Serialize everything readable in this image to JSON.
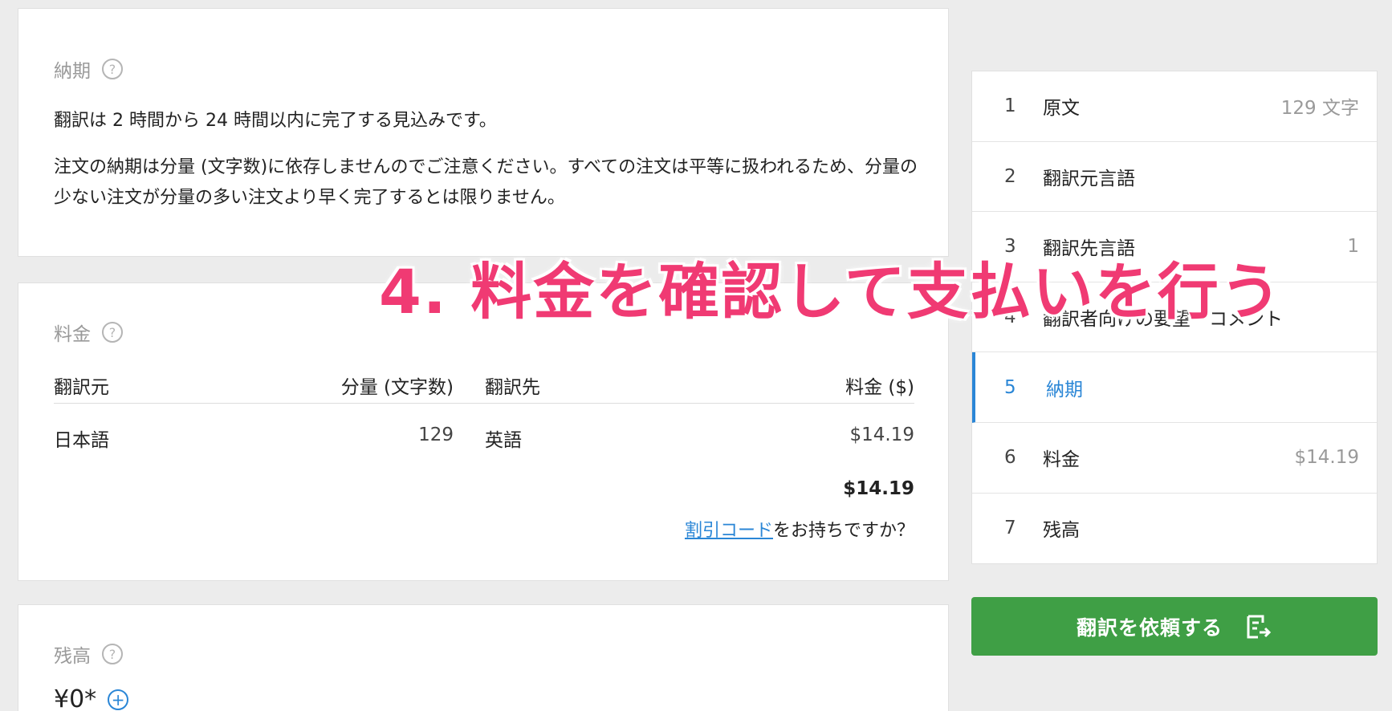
{
  "delivery": {
    "title": "納期",
    "help_icon": "?",
    "line1": "翻訳は 2 時間から 24 時間以内に完了する見込みです。",
    "line2": "注文の納期は分量 (文字数)に依存しませんのでご注意ください。すべての注文は平等に扱われるため、分量の少ない注文が分量の多い注文より早く完了するとは限りません。"
  },
  "fee": {
    "title": "料金",
    "help_icon": "?",
    "headers": {
      "source": "翻訳元",
      "volume": "分量 (文字数)",
      "target": "翻訳先",
      "price": "料金 ($)"
    },
    "rows": [
      {
        "source": "日本語",
        "volume": "129",
        "target": "英語",
        "price": "$14.19"
      }
    ],
    "total": "$14.19",
    "discount_link": "割引コード",
    "discount_suffix": "をお持ちですか？"
  },
  "balance": {
    "title": "残高",
    "help_icon": "?",
    "value": "¥0*",
    "plus_icon": "+"
  },
  "steps": [
    {
      "num": "1",
      "label": "原文",
      "value": "129 文字"
    },
    {
      "num": "2",
      "label": "翻訳元言語",
      "value": ""
    },
    {
      "num": "3",
      "label": "翻訳先言語",
      "value": "1"
    },
    {
      "num": "4",
      "label": "翻訳者向けの要望・コメント",
      "value": ""
    },
    {
      "num": "5",
      "label": "納期",
      "value": "",
      "active": true
    },
    {
      "num": "6",
      "label": "料金",
      "value": "$14.19"
    },
    {
      "num": "7",
      "label": "残高",
      "value": ""
    }
  ],
  "order_button": {
    "label": "翻訳を依頼する",
    "icon": "order-icon"
  },
  "overlay_caption": "4. 料金を確認して支払いを行う",
  "colors": {
    "accent_blue": "#2a86d6",
    "button_green": "#3f9f45",
    "caption_pink": "#f03a73"
  }
}
